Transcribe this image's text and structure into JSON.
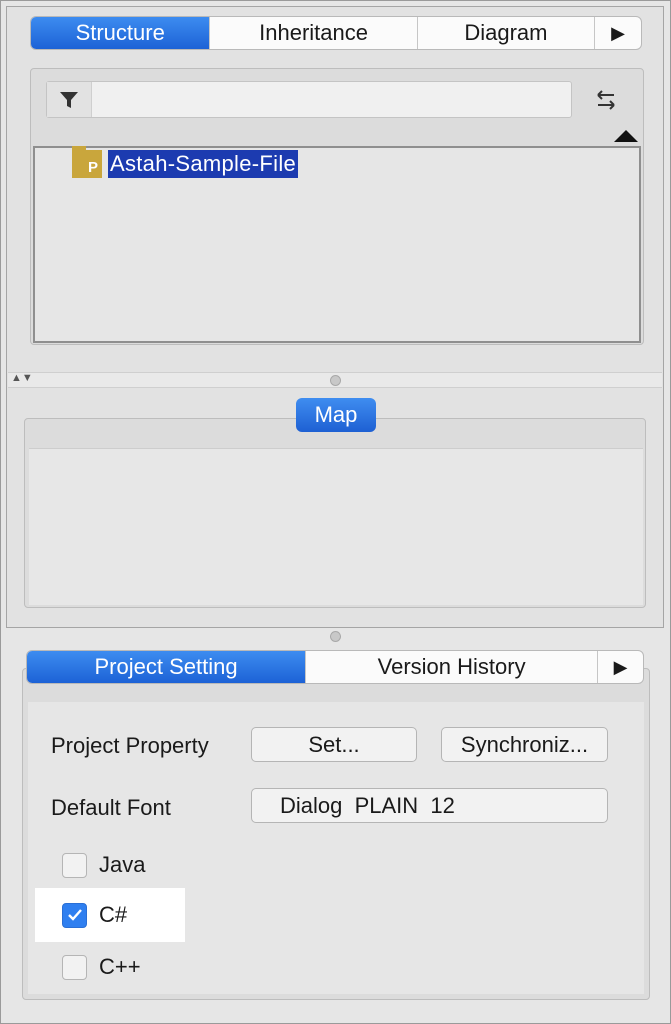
{
  "top_tabs": [
    "Structure",
    "Inheritance",
    "Diagram"
  ],
  "tab_more_glyph": "▶",
  "filter": {
    "value": "",
    "placeholder": ""
  },
  "tree": {
    "item_label": "Astah-Sample-File",
    "icon_letter": "P"
  },
  "splitter_arrows": "▲▼",
  "map": {
    "button_label": "Map"
  },
  "bottom_tabs": [
    "Project Setting",
    "Version History"
  ],
  "project_setting": {
    "project_property_label": "Project Property",
    "set_button": "Set...",
    "synchronize_button": "Synchroniz...",
    "default_font_label": "Default Font",
    "font_value": "Dialog  PLAIN  12"
  },
  "languages": [
    {
      "label": "Java",
      "checked": false
    },
    {
      "label": "C#",
      "checked": true
    },
    {
      "label": "C++",
      "checked": false
    }
  ],
  "colors": {
    "accent": "#1d62d6",
    "selection": "#1c3bb0",
    "package_icon": "#c9a63c"
  }
}
